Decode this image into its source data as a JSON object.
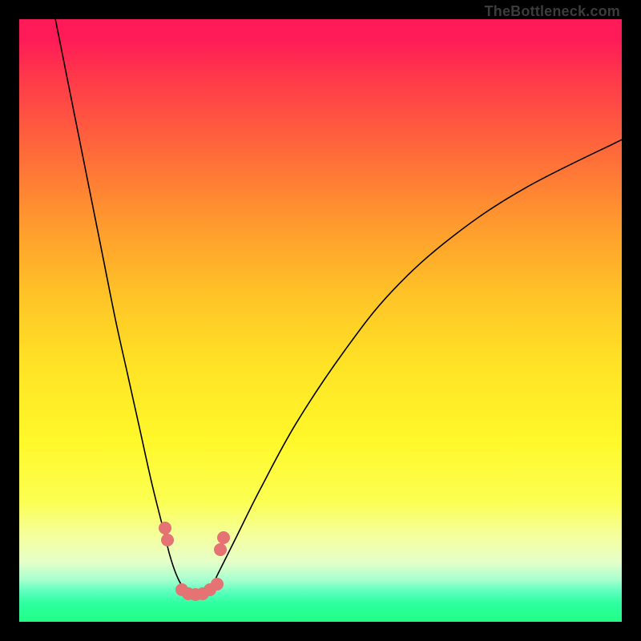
{
  "attribution": "TheBottleneck.com",
  "colors": {
    "background": "#000000",
    "curve_stroke": "#000000",
    "dot_fill": "#e57373"
  },
  "chart_data": {
    "type": "line",
    "title": "",
    "xlabel": "",
    "ylabel": "",
    "xlim": [
      0,
      100
    ],
    "ylim": [
      0,
      100
    ],
    "grid": false,
    "legend": false,
    "series": [
      {
        "name": "bottleneck-curve",
        "x": [
          6,
          8,
          10,
          12,
          14,
          16,
          18,
          20,
          22,
          24,
          25,
          26,
          27,
          28,
          29,
          30,
          31,
          32,
          33,
          36,
          40,
          46,
          54,
          62,
          72,
          84,
          100
        ],
        "values": [
          100,
          90,
          80,
          70,
          60,
          50,
          41,
          32,
          23,
          15,
          11,
          8,
          6,
          5,
          4.5,
          4.5,
          5,
          6,
          8,
          14,
          22,
          33,
          45,
          55,
          64,
          72,
          80
        ]
      }
    ],
    "markers": [
      {
        "x": 24.2,
        "y": 15.5
      },
      {
        "x": 24.6,
        "y": 13.5
      },
      {
        "x": 27.0,
        "y": 5.3
      },
      {
        "x": 28.0,
        "y": 4.7
      },
      {
        "x": 29.2,
        "y": 4.5
      },
      {
        "x": 30.5,
        "y": 4.7
      },
      {
        "x": 31.7,
        "y": 5.3
      },
      {
        "x": 32.8,
        "y": 6.3
      },
      {
        "x": 33.4,
        "y": 12.0
      },
      {
        "x": 33.9,
        "y": 14.0
      }
    ]
  }
}
